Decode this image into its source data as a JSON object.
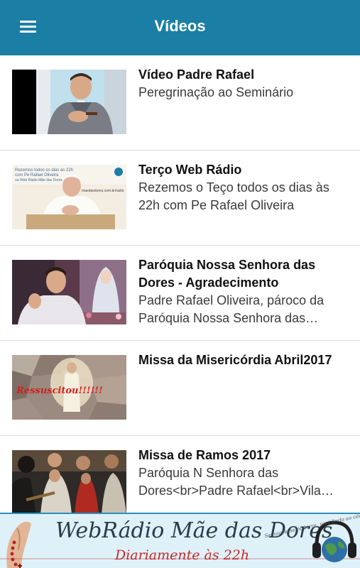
{
  "header": {
    "title": "Vídeos",
    "menu_icon": "menu-icon"
  },
  "videos": [
    {
      "title": "Vídeo Padre Rafael",
      "description": "Peregrinação ao Seminário",
      "thumbnail": "priest-portrait-thumbnail"
    },
    {
      "title": "Terço Web Rádio",
      "description": "Rezemos o Teço todos os dias às 22h com Pe Rafael Oliveira",
      "thumbnail": "pope-praying-thumbnail",
      "thumbnail_caption": "Rezemos todos os dias às 22h com Pe Rafael Oliveira na Web Rádio Mãe das Dores",
      "thumbnail_url": "maedasdores.com.br/radio"
    },
    {
      "title": "Paróquia Nossa Senhora das Dores - Agradecimento",
      "description": "Padre Rafael Oliveira, pároco da Paróquia Nossa Senhora das…",
      "thumbnail": "priest-with-statue-thumbnail"
    },
    {
      "title": "Missa da Misericórdia Abril2017",
      "description": "",
      "thumbnail": "resurrection-thumbnail",
      "thumbnail_caption": "Ressuscitou!!!!!!"
    },
    {
      "title": "Missa de Ramos 2017",
      "description": "Paróquia N Senhora das Dores<br>Padre Rafael<br>Vila…",
      "thumbnail": "choir-band-thumbnail"
    }
  ],
  "banner": {
    "title": "WebRádio Mãe das Dores",
    "subtitle": "Diariamente às 22h",
    "tagline": "Se houvesse no terra, será lindo ao céu",
    "icons": [
      "rosary-hands-icon",
      "globe-headphones-icon"
    ]
  },
  "colors": {
    "appbar": "#1a7ea5",
    "banner_bg": "#dff1f8",
    "banner_subtitle": "#c8272a",
    "divider": "#d9d9d9"
  }
}
